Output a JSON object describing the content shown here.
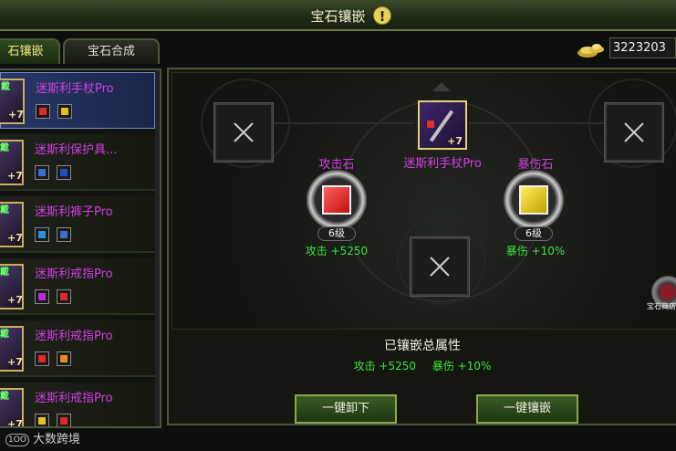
{
  "window": {
    "title": "宝石镶嵌",
    "alert_icon": "exclamation-icon"
  },
  "tabs": [
    {
      "label": "石镶嵌",
      "active": true
    },
    {
      "label": "宝石合成",
      "active": false
    }
  ],
  "currency": {
    "icon": "gold-ingot-icon",
    "amount": "3223203"
  },
  "equipment_list": [
    {
      "badge": "戴",
      "name": "迷斯利手杖Pro",
      "plus": "+7",
      "selected": true,
      "gems": [
        "#e02828",
        "#e8c020"
      ]
    },
    {
      "badge": "戴",
      "name": "迷斯利保护具...",
      "plus": "+7",
      "selected": false,
      "gems": [
        "#3a70d0",
        "#2050c0"
      ]
    },
    {
      "badge": "戴",
      "name": "迷斯利裤子Pro",
      "plus": "+7",
      "selected": false,
      "gems": [
        "#2a90e0",
        "#3a70d0"
      ]
    },
    {
      "badge": "戴",
      "name": "迷斯利戒指Pro",
      "plus": "+7",
      "selected": false,
      "gems": [
        "#b030d0",
        "#e02828"
      ]
    },
    {
      "badge": "戴",
      "name": "迷斯利戒指Pro",
      "plus": "+7",
      "selected": false,
      "gems": [
        "#e02828",
        "#e88a20"
      ]
    },
    {
      "badge": "戴",
      "name": "迷斯利戒指Pro",
      "plus": "+7",
      "selected": false,
      "gems": [
        "#e8c020",
        "#e02828"
      ]
    }
  ],
  "socket": {
    "item_name": "迷斯利手杖Pro",
    "item_plus": "+7",
    "left_gem": {
      "name": "攻击石",
      "level": "6级",
      "effect": "攻击 +5250",
      "color": "#e02828"
    },
    "right_gem": {
      "name": "暴伤石",
      "level": "6级",
      "effect": "暴伤 +10%",
      "color": "#e8d020"
    },
    "shop_label": "宝石商店"
  },
  "summary": {
    "title": "已镶嵌总属性",
    "attrs": [
      "攻击 +5250",
      "暴伤 +10%"
    ]
  },
  "buttons": {
    "unequip_all": "一键卸下",
    "equip_all": "一键镶嵌"
  },
  "watermark": {
    "logo": "1OO",
    "text": "大数跨境"
  }
}
